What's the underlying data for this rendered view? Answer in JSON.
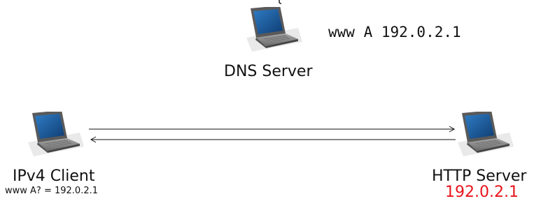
{
  "dns_server": {
    "label": "DNS Server",
    "record": "www A 192.0.2.1"
  },
  "client": {
    "label": "IPv4 Client",
    "query_result": "www A? = 192.0.2.1"
  },
  "http_server": {
    "label": "HTTP Server",
    "address": "192.0.2.1"
  },
  "colors": {
    "accent": "#e8141c",
    "screen": "#1a5a9c"
  },
  "icons": [
    "laptop-icon",
    "laptop-icon",
    "laptop-icon"
  ]
}
